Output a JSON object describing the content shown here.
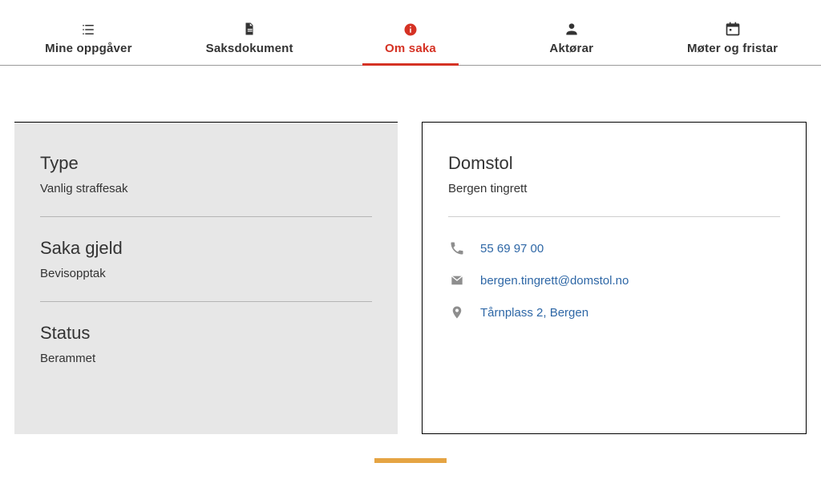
{
  "tabs": [
    {
      "label": "Mine oppgåver"
    },
    {
      "label": "Saksdokument"
    },
    {
      "label": "Om saka"
    },
    {
      "label": "Aktørar"
    },
    {
      "label": "Møter og fristar"
    }
  ],
  "case_info": {
    "type_heading": "Type",
    "type_value": "Vanlig straffesak",
    "concerns_heading": "Saka gjeld",
    "concerns_value": "Bevisopptak",
    "status_heading": "Status",
    "status_value": "Berammet"
  },
  "court": {
    "heading": "Domstol",
    "name": "Bergen tingrett",
    "phone": "55 69 97 00",
    "email": "bergen.tingrett@domstol.no",
    "address": "Tårnplass 2, Bergen"
  },
  "colors": {
    "accent": "#d53224",
    "link": "#2e67a6"
  }
}
